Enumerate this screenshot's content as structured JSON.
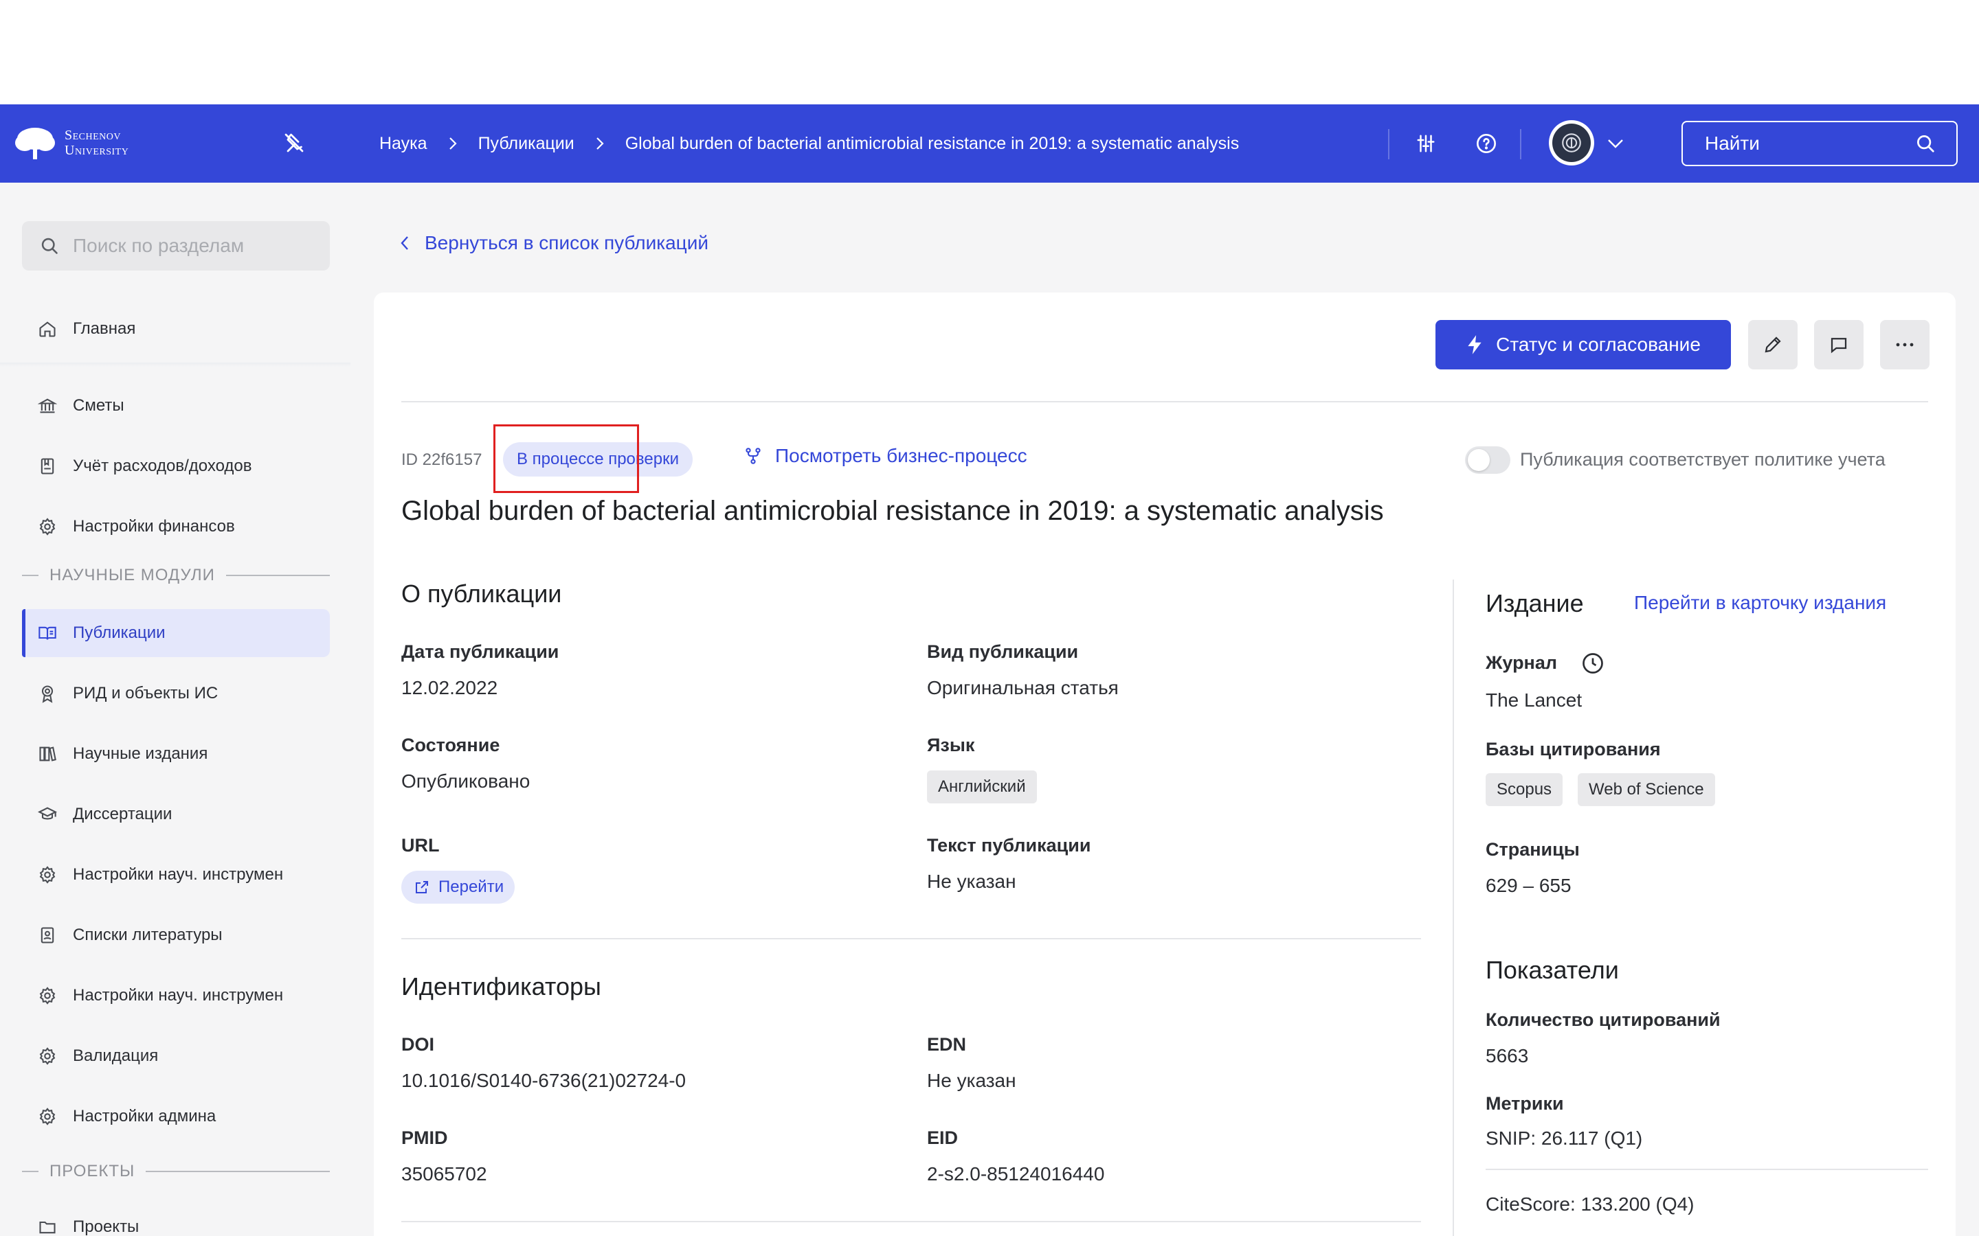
{
  "header": {
    "logo_line1": "Sechenov",
    "logo_line2": "University",
    "breadcrumbs": [
      "Наука",
      "Публикации",
      "Global burden of bacterial antimicrobial resistance in 2019: a systematic analysis"
    ],
    "search_placeholder": "Найти"
  },
  "sidebar": {
    "search_placeholder": "Поиск по разделам",
    "items": [
      {
        "label": "Главная",
        "icon": "home-icon"
      },
      {
        "label": "Сметы",
        "icon": "bank-icon"
      },
      {
        "label": "Учёт расходов/доходов",
        "icon": "ledger-icon"
      },
      {
        "label": "Настройки финансов",
        "icon": "gear-icon"
      },
      {
        "label": "Публикации",
        "icon": "book-icon"
      },
      {
        "label": "РИД и объекты ИС",
        "icon": "award-icon"
      },
      {
        "label": "Научные издания",
        "icon": "books-icon"
      },
      {
        "label": "Диссертации",
        "icon": "graduation-icon"
      },
      {
        "label": "Настройки науч. инструмен",
        "icon": "gear-icon"
      },
      {
        "label": "Списки литературы",
        "icon": "list-icon"
      },
      {
        "label": "Настройки науч. инструмен",
        "icon": "gear-icon"
      },
      {
        "label": "Валидация",
        "icon": "gear-icon"
      },
      {
        "label": "Настройки админа",
        "icon": "gear-icon"
      },
      {
        "label": "Проекты",
        "icon": "folder-icon"
      }
    ],
    "section_science": "НАУЧНЫЕ МОДУЛИ",
    "section_projects": "ПРОЕКТЫ",
    "active_item": "Публикации"
  },
  "page": {
    "back_label": "Вернуться в список публикаций",
    "status_button": "Статус и согласование",
    "id_label": "ID 22f6157",
    "status_badge": "В процессе проверки",
    "business_process_link": "Посмотреть бизнес-процесс",
    "policy_toggle_label": "Публикация соответствует политике учета",
    "policy_toggle_on": false,
    "title": "Global burden of bacterial antimicrobial resistance in 2019: a systematic analysis"
  },
  "about": {
    "heading": "О публикации",
    "date_label": "Дата публикации",
    "date_value": "12.02.2022",
    "type_label": "Вид публикации",
    "type_value": "Оригинальная статья",
    "state_label": "Состояние",
    "state_value": "Опубликовано",
    "lang_label": "Язык",
    "lang_value": "Английский",
    "url_label": "URL",
    "url_link": "Перейти",
    "text_label": "Текст публикации",
    "text_value": "Не указан"
  },
  "identifiers": {
    "heading": "Идентификаторы",
    "doi_label": "DOI",
    "doi_value": "10.1016/S0140-6736(21)02724-0",
    "edn_label": "EDN",
    "edn_value": "Не указан",
    "pmid_label": "PMID",
    "pmid_value": "35065702",
    "eid_label": "EID",
    "eid_value": "2-s2.0-85124016440"
  },
  "edition": {
    "heading": "Издание",
    "card_link": "Перейти в карточку издания",
    "journal_label": "Журнал",
    "journal_value": "The Lancet",
    "citation_bases_label": "Базы цитирования",
    "citation_bases": [
      "Scopus",
      "Web of Science"
    ],
    "pages_label": "Страницы",
    "pages_value": "629 – 655"
  },
  "metrics": {
    "heading": "Показатели",
    "citations_label": "Количество цитирований",
    "citations_value": "5663",
    "metrics_label": "Метрики",
    "snip": "SNIP: 26.117 (Q1)",
    "citescore": "CiteScore: 133.200 (Q4)"
  },
  "colors": {
    "accent": "#3447d8",
    "highlight": "#e02020"
  }
}
